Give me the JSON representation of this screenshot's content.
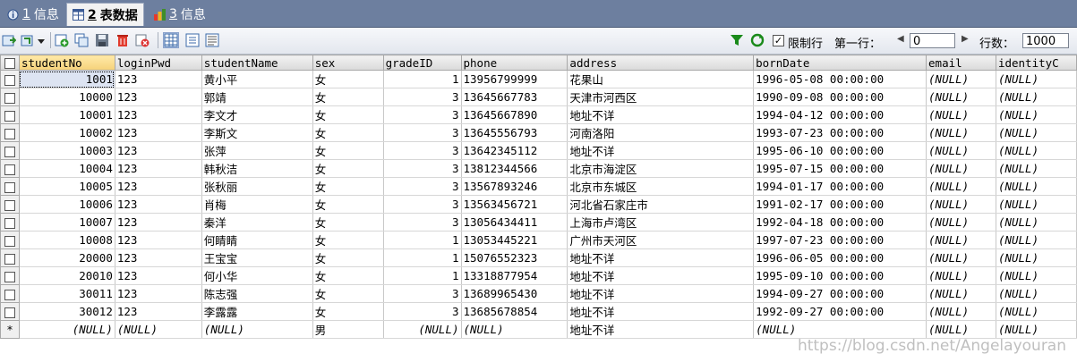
{
  "tabs": [
    {
      "num": "1",
      "label": "信息"
    },
    {
      "num": "2",
      "label": "表数据"
    },
    {
      "num": "3",
      "label": "信息"
    }
  ],
  "toolbar": {
    "limit_label": "限制行",
    "first_row_label": "第一行：",
    "first_row_value": "0",
    "rows_label": "行数：",
    "rows_value": "1000",
    "limit_checked": "✓"
  },
  "grid": {
    "columns": [
      "studentNo",
      "loginPwd",
      "studentName",
      "sex",
      "gradeID",
      "phone",
      "address",
      "bornDate",
      "email",
      "identityC"
    ],
    "rows": [
      [
        "1001",
        "123",
        "黄小平",
        "女",
        "1",
        "13956799999",
        "花果山",
        "1996-05-08 00:00:00",
        "(NULL)",
        "(NULL)"
      ],
      [
        "10000",
        "123",
        "郭靖",
        "女",
        "3",
        "13645667783",
        "天津市河西区",
        "1990-09-08 00:00:00",
        "(NULL)",
        "(NULL)"
      ],
      [
        "10001",
        "123",
        "李文才",
        "女",
        "3",
        "13645667890",
        "地址不详",
        "1994-04-12 00:00:00",
        "(NULL)",
        "(NULL)"
      ],
      [
        "10002",
        "123",
        "李斯文",
        "女",
        "3",
        "13645556793",
        "河南洛阳",
        "1993-07-23 00:00:00",
        "(NULL)",
        "(NULL)"
      ],
      [
        "10003",
        "123",
        "张萍",
        "女",
        "3",
        "13642345112",
        "地址不详",
        "1995-06-10 00:00:00",
        "(NULL)",
        "(NULL)"
      ],
      [
        "10004",
        "123",
        "韩秋洁",
        "女",
        "3",
        "13812344566",
        "北京市海淀区",
        "1995-07-15 00:00:00",
        "(NULL)",
        "(NULL)"
      ],
      [
        "10005",
        "123",
        "张秋丽",
        "女",
        "3",
        "13567893246",
        "北京市东城区",
        "1994-01-17 00:00:00",
        "(NULL)",
        "(NULL)"
      ],
      [
        "10006",
        "123",
        "肖梅",
        "女",
        "3",
        "13563456721",
        "河北省石家庄市",
        "1991-02-17 00:00:00",
        "(NULL)",
        "(NULL)"
      ],
      [
        "10007",
        "123",
        "秦洋",
        "女",
        "3",
        "13056434411",
        "上海市卢湾区",
        "1992-04-18 00:00:00",
        "(NULL)",
        "(NULL)"
      ],
      [
        "10008",
        "123",
        "何睛睛",
        "女",
        "1",
        "13053445221",
        "广州市天河区",
        "1997-07-23 00:00:00",
        "(NULL)",
        "(NULL)"
      ],
      [
        "20000",
        "123",
        "王宝宝",
        "女",
        "1",
        "15076552323",
        "地址不详",
        "1996-06-05 00:00:00",
        "(NULL)",
        "(NULL)"
      ],
      [
        "20010",
        "123",
        "何小华",
        "女",
        "1",
        "13318877954",
        "地址不详",
        "1995-09-10 00:00:00",
        "(NULL)",
        "(NULL)"
      ],
      [
        "30011",
        "123",
        "陈志强",
        "女",
        "3",
        "13689965430",
        "地址不详",
        "1994-09-27 00:00:00",
        "(NULL)",
        "(NULL)"
      ],
      [
        "30012",
        "123",
        "李露露",
        "女",
        "3",
        "13685678854",
        "地址不详",
        "1992-09-27 00:00:00",
        "(NULL)",
        "(NULL)"
      ]
    ],
    "new_row": [
      "(NULL)",
      "(NULL)",
      "(NULL)",
      "男",
      "(NULL)",
      "(NULL)",
      "地址不详",
      "(NULL)",
      "(NULL)",
      "(NULL)"
    ],
    "new_row_marker": "*"
  },
  "watermark": "https://blog.csdn.net/Angelayouran",
  "colors": {
    "tabbar": "#6d7f9f",
    "selected_row": "#dde4f2",
    "filter_icon": "#1a8a1a"
  }
}
